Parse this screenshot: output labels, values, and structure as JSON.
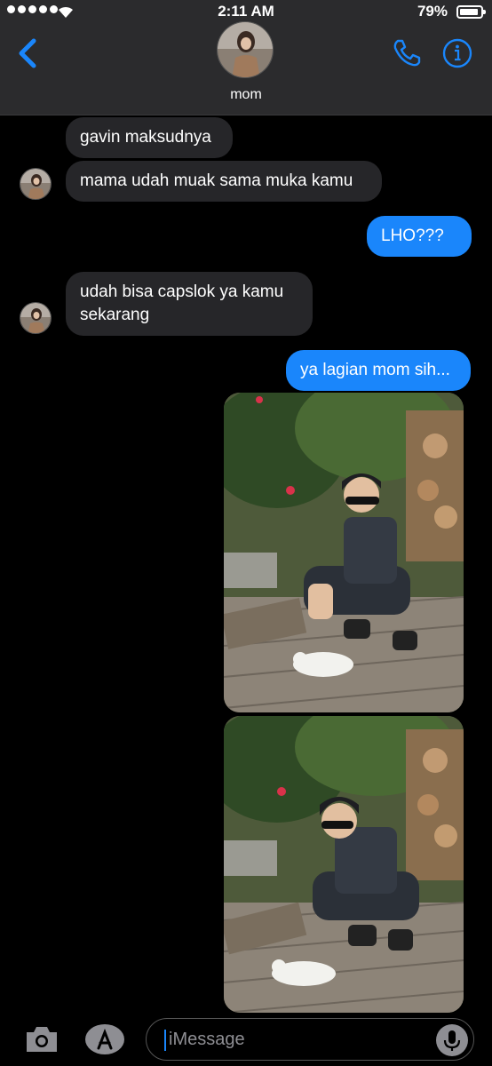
{
  "status_bar": {
    "time": "2:11 AM",
    "battery": "79%"
  },
  "header": {
    "contact_name": "mom"
  },
  "colors": {
    "accent": "#1a86fb",
    "incoming_bubble": "#262629",
    "header_bg": "#2b2b2d"
  },
  "icons": [
    "chevron-left-icon",
    "phone-icon",
    "info-icon",
    "camera-icon",
    "app-store-icon",
    "microphone-icon",
    "wifi-icon"
  ],
  "messages": [
    {
      "direction": "incoming",
      "text": "gavin maksudnya"
    },
    {
      "direction": "incoming",
      "text": "mama udah muak sama muka kamu"
    },
    {
      "direction": "outgoing",
      "text": "LHO???"
    },
    {
      "direction": "incoming",
      "text": "udah bisa capslok ya kamu sekarang"
    },
    {
      "direction": "outgoing",
      "text": "ya lagian mom sih..."
    },
    {
      "direction": "outgoing",
      "type": "photo"
    },
    {
      "direction": "outgoing",
      "type": "photo"
    }
  ],
  "composer": {
    "placeholder": "iMessage"
  }
}
